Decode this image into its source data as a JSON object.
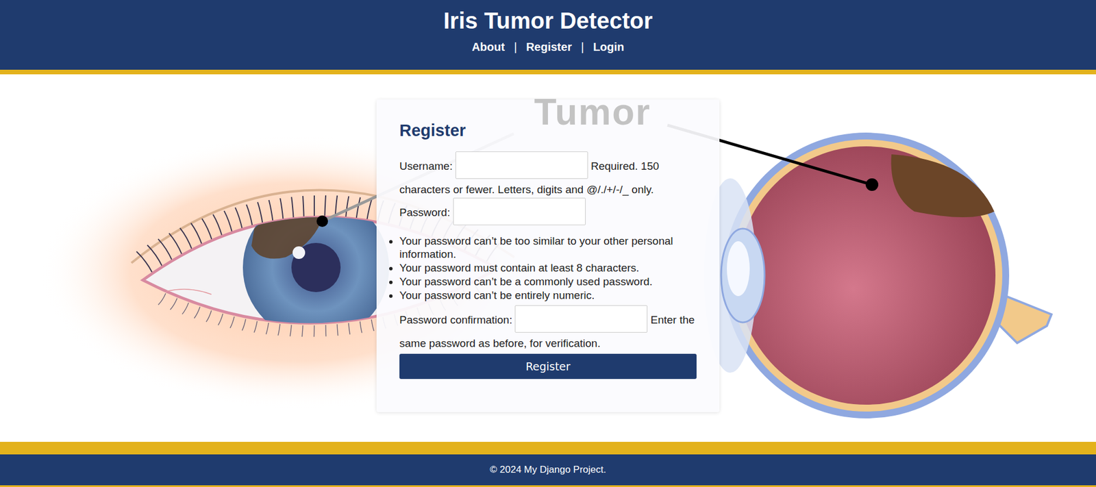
{
  "header": {
    "title": "Iris Tumor Detector",
    "nav": [
      {
        "label": "About"
      },
      {
        "label": "Register"
      },
      {
        "label": "Login"
      }
    ],
    "separator": "|"
  },
  "illustration": {
    "label": "Tumor"
  },
  "form": {
    "title": "Register",
    "fields": [
      {
        "kind": "inline",
        "label": "Username:",
        "type": "text",
        "value": "",
        "help": "Required. 150 characters or fewer. Letters, digits and @/./+/-/_ only.",
        "help_items": []
      },
      {
        "kind": "list",
        "label": "Password:",
        "type": "password",
        "value": "",
        "help": "",
        "help_items": [
          "Your password can’t be too similar to your other personal information.",
          "Your password must contain at least 8 characters.",
          "Your password can’t be a commonly used password.",
          "Your password can’t be entirely numeric."
        ]
      },
      {
        "kind": "inline",
        "label": "Password confirmation:",
        "type": "password",
        "value": "",
        "help": "Enter the same password as before, for verification.",
        "help_items": []
      }
    ],
    "submit": "Register"
  },
  "footer": {
    "text": "© 2024 My Django Project."
  }
}
